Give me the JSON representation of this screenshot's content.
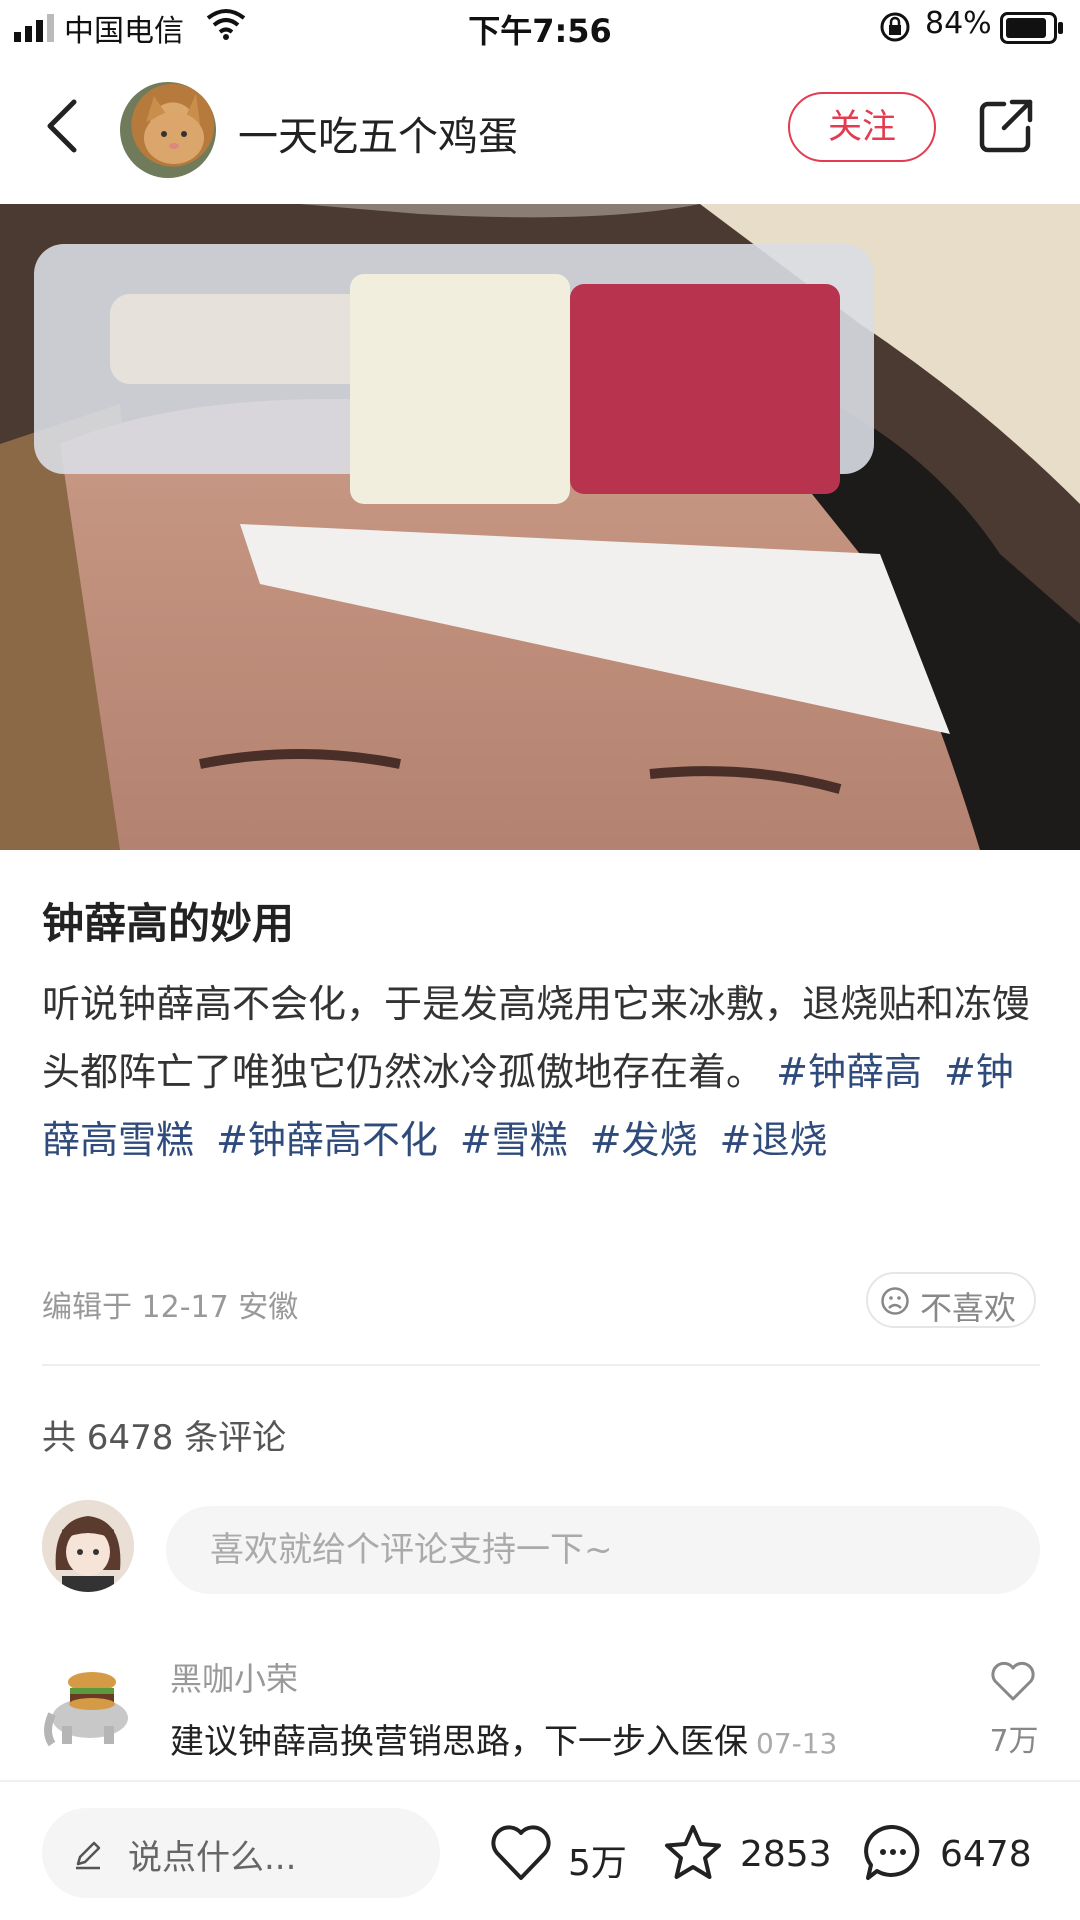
{
  "status_bar": {
    "carrier": "中国电信",
    "time": "下午7:56",
    "battery": "84%"
  },
  "header": {
    "username": "一天吃五个鸡蛋",
    "follow_label": "关注"
  },
  "post": {
    "title": "钟薛高的妙用",
    "body": "听说钟薛高不会化，于是发高烧用它来冰敷，退烧贴和冻馒头都阵亡了唯独它仍然冰冷孤傲地存在着。",
    "tags": [
      "#钟薛高",
      "#钟薛高雪糕",
      "#钟薛高不化",
      "#雪糕",
      "#发烧",
      "#退烧"
    ],
    "meta": "编辑于 12-17 安徽",
    "dislike_label": "不喜欢"
  },
  "comments": {
    "total_label": "共 6478 条评论",
    "input_placeholder": "喜欢就给个评论支持一下~",
    "items": [
      {
        "author": "黑咖小荣",
        "text": "建议钟薛高换营销思路，下一步入医保",
        "date": "07-13",
        "likes": "7万"
      }
    ]
  },
  "bottom_bar": {
    "say_placeholder": "说点什么...",
    "likes": "5万",
    "favorites": "2853",
    "comments": "6478"
  },
  "colors": {
    "accent": "#e33b4f",
    "tag": "#2f4b7c"
  }
}
